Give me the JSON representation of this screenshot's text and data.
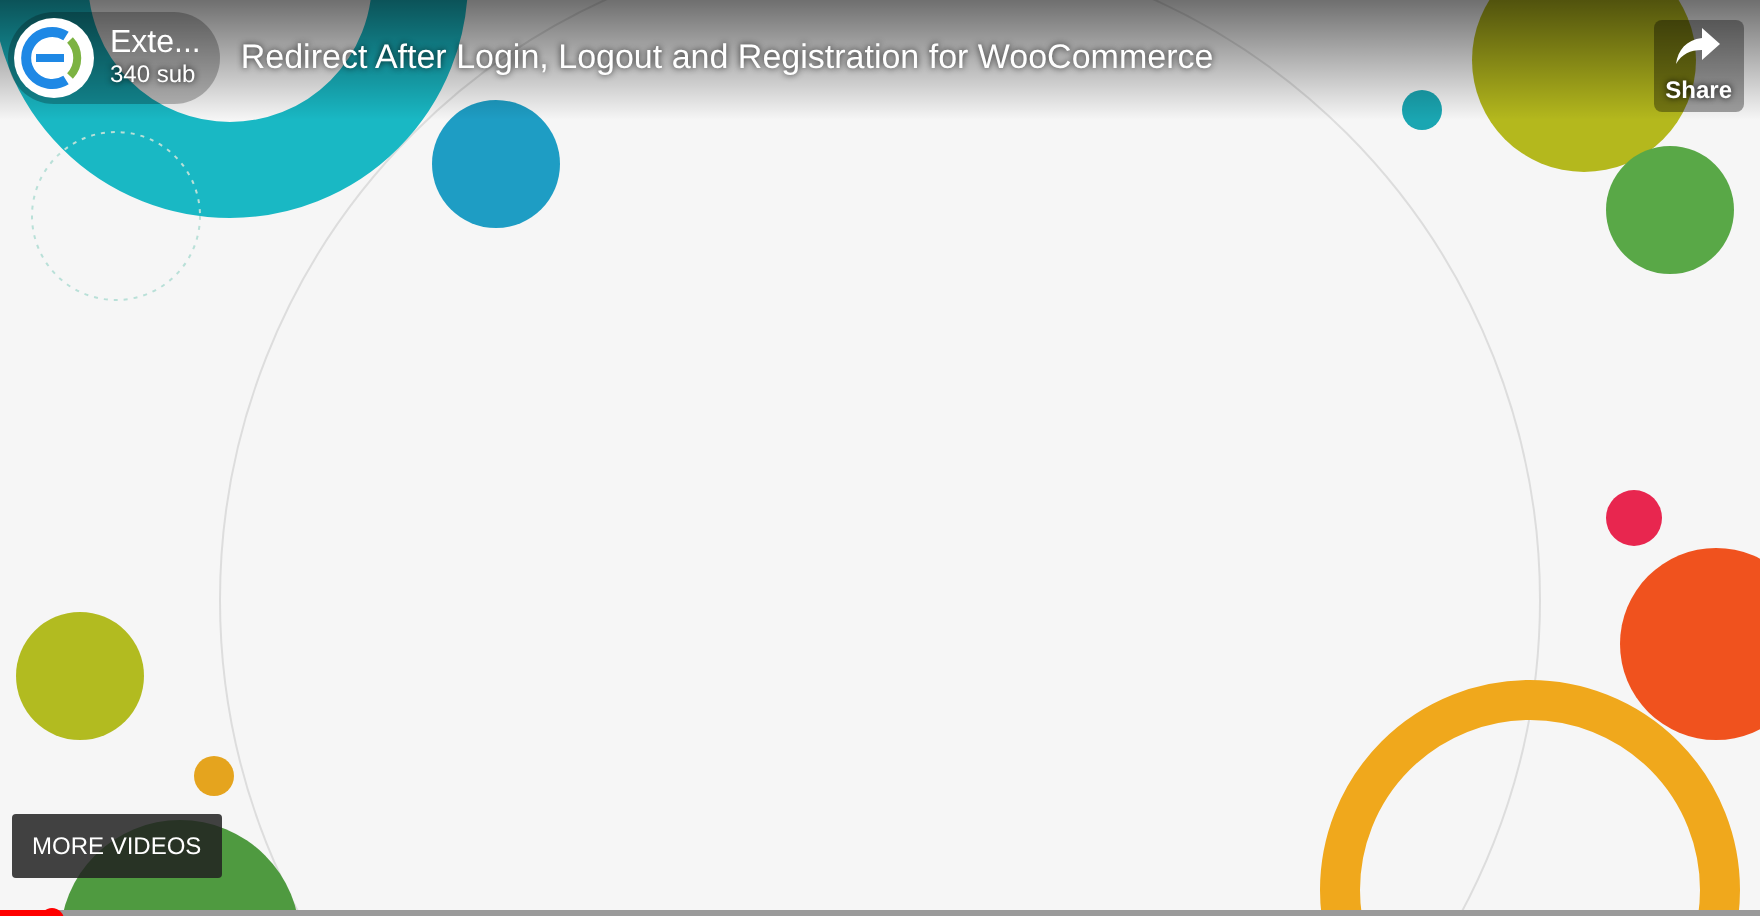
{
  "channel": {
    "name": "Exte...",
    "subscribers": "340 sub"
  },
  "video": {
    "title": "Redirect After Login, Logout and Registration for WooCommerce"
  },
  "share": {
    "label": "Share"
  },
  "more_videos": {
    "label": "MORE VIDEOS"
  },
  "progress": {
    "level": 0.03
  }
}
